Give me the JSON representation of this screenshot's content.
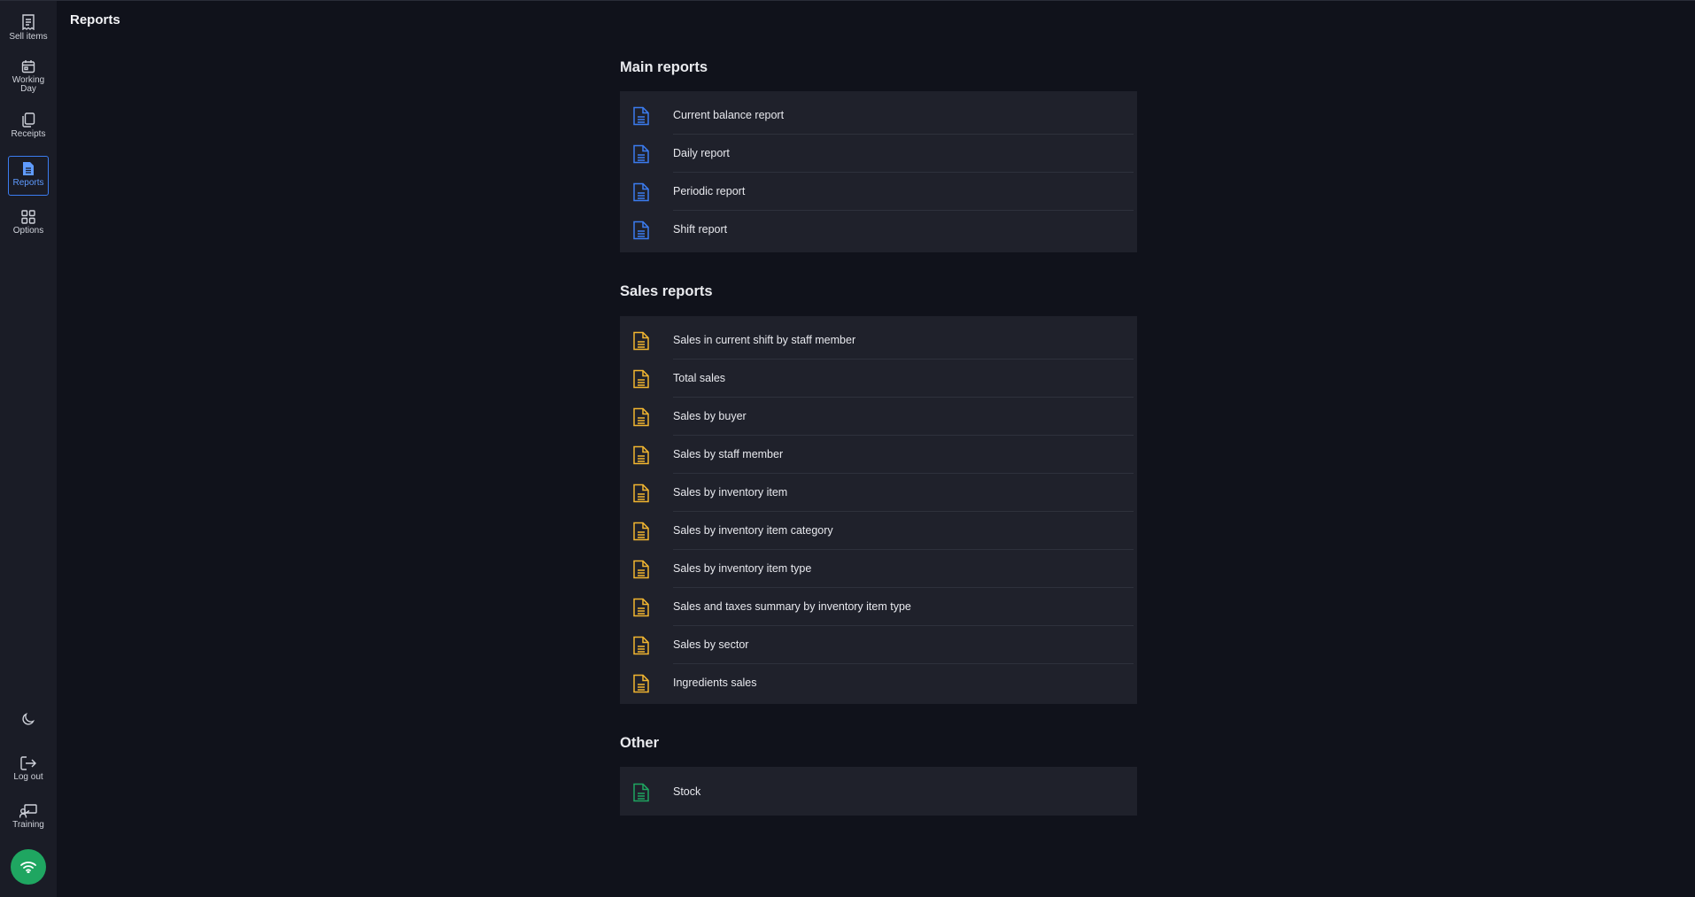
{
  "sidebar": {
    "items": [
      {
        "label": "Sell items",
        "icon": "receipt-list-icon"
      },
      {
        "label": "Working Day",
        "icon": "calendar-icon"
      },
      {
        "label": "Receipts",
        "icon": "copy-icon"
      },
      {
        "label": "Reports",
        "icon": "document-icon",
        "active": true
      },
      {
        "label": "Options",
        "icon": "grid-icon"
      }
    ],
    "bottom": [
      {
        "label": "",
        "icon": "moon-icon"
      },
      {
        "label": "Log out",
        "icon": "logout-icon"
      },
      {
        "label": "Training",
        "icon": "training-icon"
      }
    ],
    "status_icon": "wifi-icon"
  },
  "header": {
    "title": "Reports"
  },
  "sections": [
    {
      "title": "Main reports",
      "icon_color": "#3b7cf0",
      "items": [
        "Current balance report",
        "Daily report",
        "Periodic report",
        "Shift report"
      ]
    },
    {
      "title": "Sales reports",
      "icon_color": "#f2b630",
      "items": [
        "Sales in current shift by staff member",
        "Total sales",
        "Sales by buyer",
        "Sales by staff member",
        "Sales by inventory item",
        "Sales by inventory item category",
        "Sales by inventory item type",
        "Sales and taxes summary by inventory item type",
        "Sales by sector",
        "Ingredients sales"
      ]
    },
    {
      "title": "Other",
      "icon_color": "#1fa661",
      "items": [
        "Stock"
      ]
    }
  ],
  "colors": {
    "background": "#10121b",
    "sidebar": "#1a1c26",
    "card": "#1f212b",
    "accent": "#3b7cf0",
    "success": "#1fa661"
  }
}
